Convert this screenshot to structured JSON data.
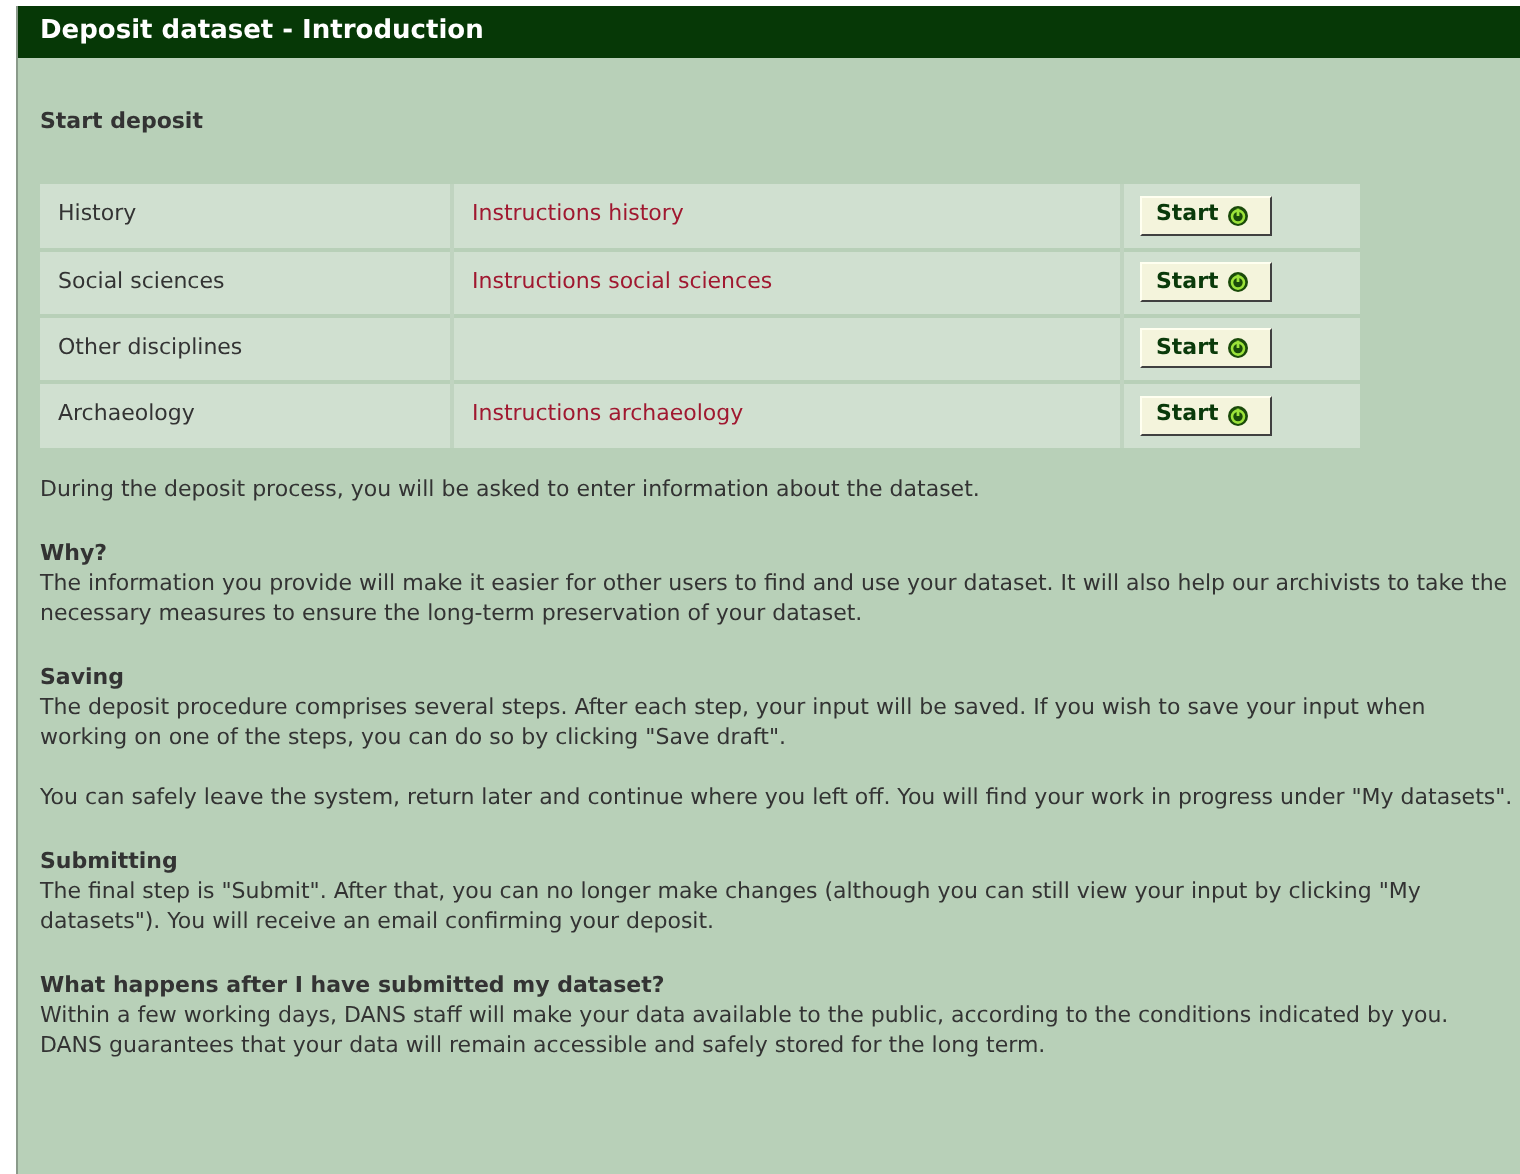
{
  "title": "Deposit dataset - Introduction",
  "heading": "Start deposit",
  "disciplines": [
    {
      "name": "History",
      "instructions": "Instructions history",
      "button": "Start"
    },
    {
      "name": "Social sciences",
      "instructions": "Instructions social sciences",
      "button": "Start"
    },
    {
      "name": "Other disciplines",
      "button": "Start"
    },
    {
      "name": "Archaeology",
      "instructions": "Instructions archaeology",
      "button": "Start"
    }
  ],
  "intro": "During the deposit process, you will be asked to enter information about the dataset.",
  "sections": [
    {
      "heading": "Why?",
      "paragraphs": [
        "The information you provide will make it easier for other users to find and use your dataset. It will also help our archivists to take the necessary measures to ensure the long-term preservation of your dataset."
      ]
    },
    {
      "heading": "Saving",
      "paragraphs": [
        "The deposit procedure comprises several steps. After each step, your input will be saved. If you wish to save your input when working on one of the steps, you can do so by clicking \"Save draft\".",
        "You can safely leave the system, return later and continue where you left off. You will find your work in progress under \"My datasets\"."
      ]
    },
    {
      "heading": "Submitting",
      "paragraphs": [
        "The final step is \"Submit\". After that, you can no longer make changes (although you can still view your input by clicking \"My datasets\"). You will receive an email confirming your deposit."
      ]
    },
    {
      "heading": "What happens after I have submitted my dataset?",
      "paragraphs": [
        "Within a few working days, DANS staff will make your data available to the public, according to the conditions indicated by you. DANS guarantees that your data will remain accessible and safely stored for the long term."
      ]
    }
  ]
}
